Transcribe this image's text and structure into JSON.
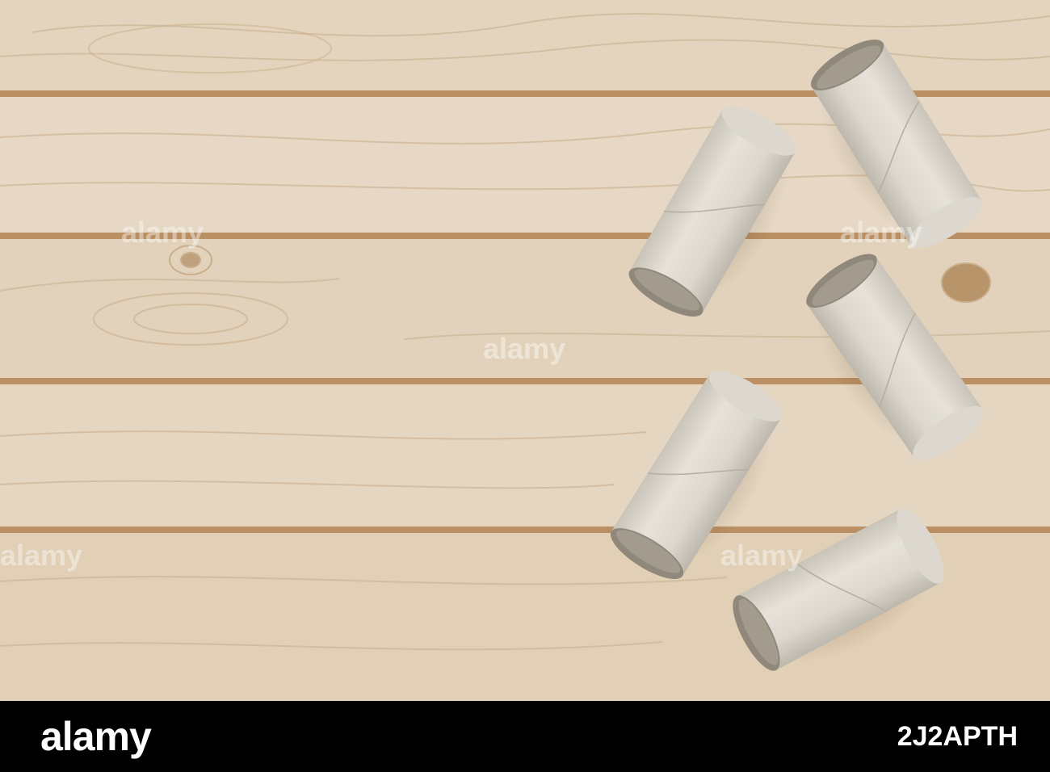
{
  "photo": {
    "subject": "Empty toilet paper rolls on a light wooden table",
    "roll_count": 5,
    "colors": {
      "wood_light": "#e3d2ba",
      "wood_mid": "#d4bfa3",
      "plank_gap": "#b98f63",
      "cardboard": "#dcd8cf",
      "cardboard_shade": "#c2bdb2"
    },
    "watermark": "alamy"
  },
  "footer": {
    "logo": "alamy",
    "image_id": "2J2APTH"
  }
}
